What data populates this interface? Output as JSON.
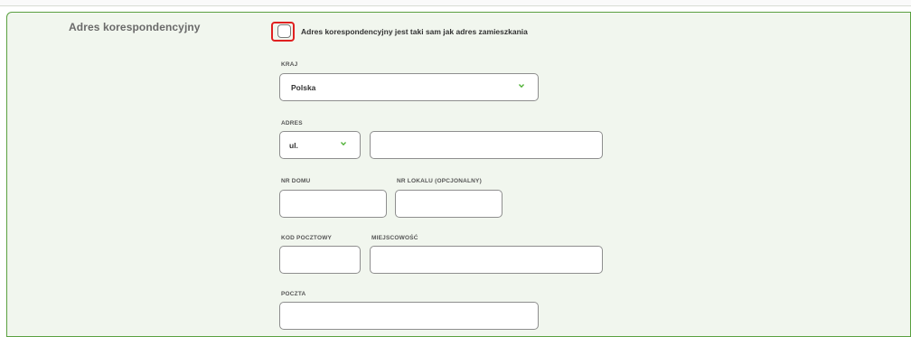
{
  "section": {
    "title": "Adres korespondencyjny",
    "same_address_label": "Adres korespondencyjny jest taki sam jak adres zamieszkania",
    "same_address_checked": false
  },
  "fields": {
    "country": {
      "label": "KRAJ",
      "value": "Polska"
    },
    "address": {
      "label": "ADRES",
      "street_prefix": "ul.",
      "street_value": ""
    },
    "house_number": {
      "label": "NR DOMU",
      "value": ""
    },
    "apartment_number": {
      "label": "NR LOKALU (OPCJONALNY)",
      "value": ""
    },
    "postal_code": {
      "label": "KOD POCZTOWY",
      "value": ""
    },
    "city": {
      "label": "MIEJSCOWOŚĆ",
      "value": ""
    },
    "post_office": {
      "label": "POCZTA",
      "value": ""
    }
  },
  "colors": {
    "panel_border": "#5aa040",
    "panel_background": "#f1f6ee",
    "chevron": "#4caf32",
    "highlight": "#e02020"
  }
}
